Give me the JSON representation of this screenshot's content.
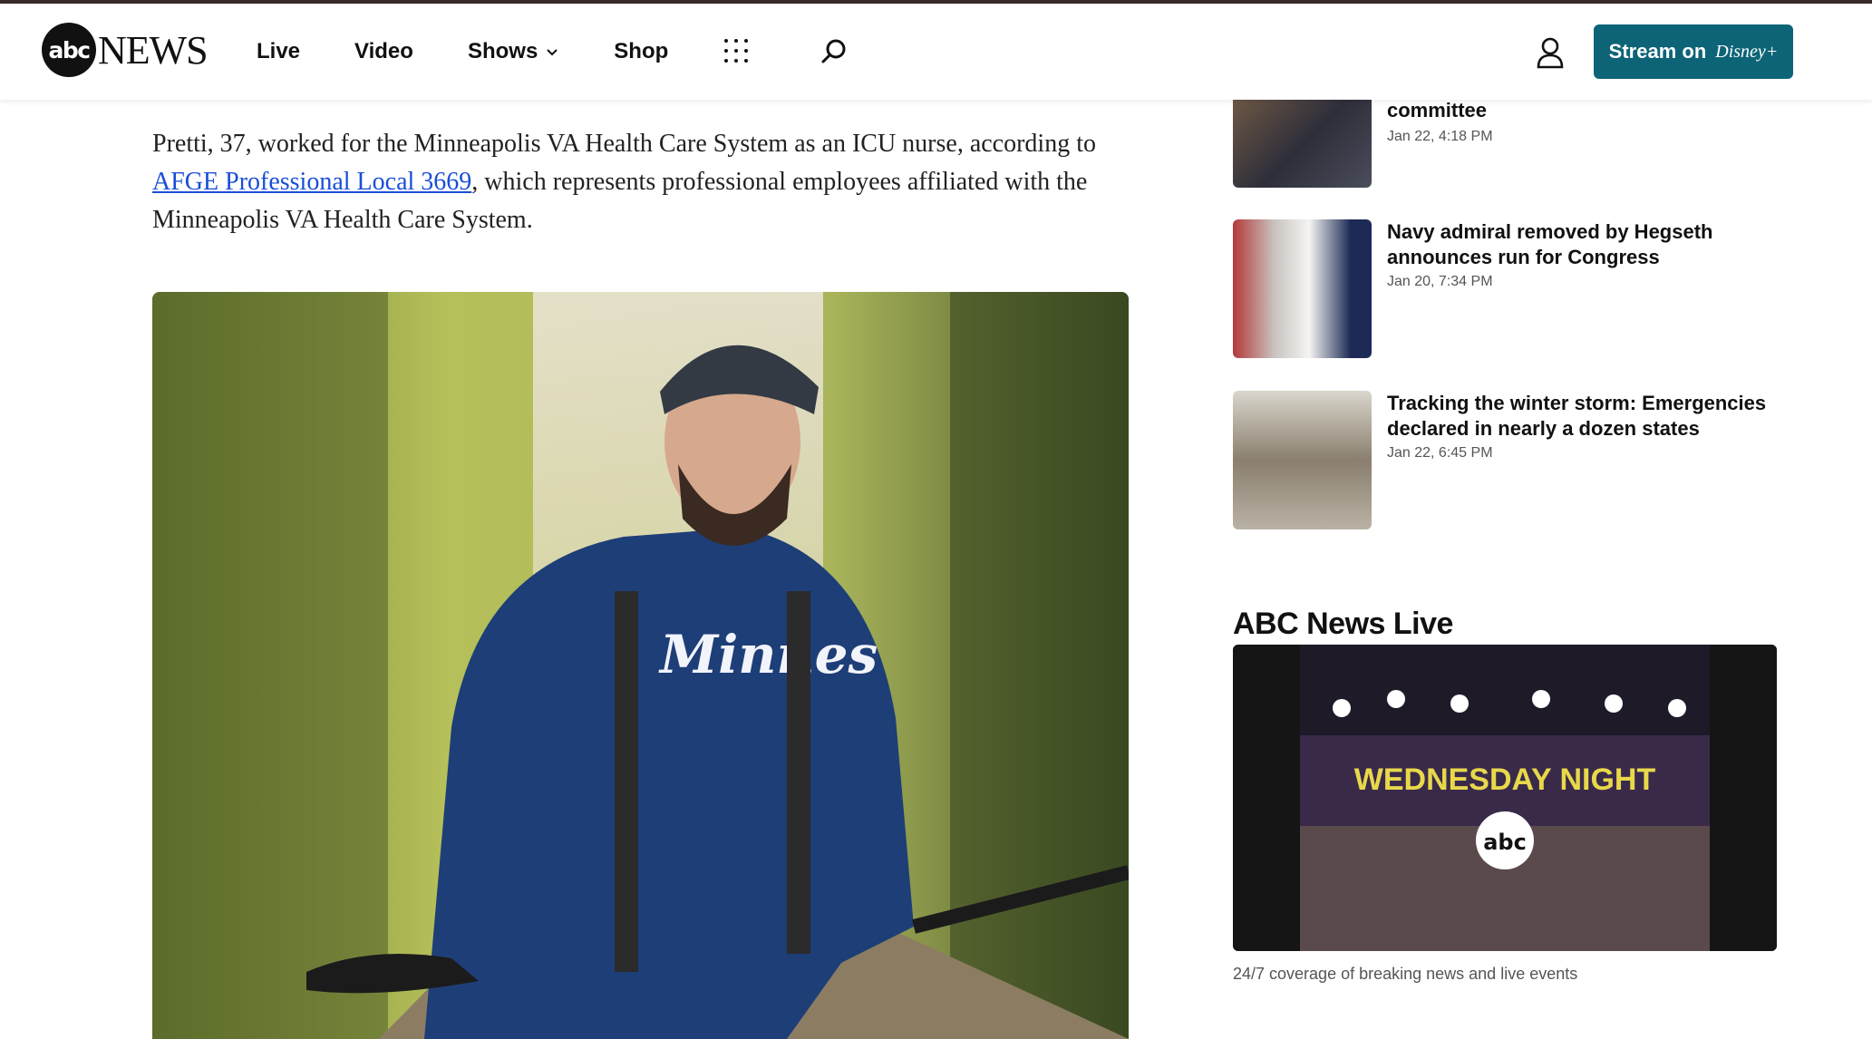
{
  "header": {
    "logo_abc": "abc",
    "logo_news": "NEWS",
    "nav": [
      "Live",
      "Video",
      "Shows",
      "Shop"
    ],
    "stream_label": "Stream on",
    "stream_brand": "Disney+"
  },
  "article": {
    "para_before_link": "Pretti, 37, worked for the Minneapolis VA Health Care System as an ICU nurse, according to ",
    "link_text": "AFGE Professional Local 3669",
    "para_after_link": ", which represents professional employees affiliated with the Minneapolis VA Health Care System.",
    "photo_jersey_text": "Minnes"
  },
  "sidebar": {
    "items": [
      {
        "title": "committee",
        "date": "Jan 22, 4:18 PM"
      },
      {
        "title": "Navy admiral removed by Hegseth announces run for Congress",
        "date": "Jan 20, 7:34 PM"
      },
      {
        "title": "Tracking the winter storm: Emergencies declared in nearly a dozen states",
        "date": "Jan 22, 6:45 PM"
      }
    ]
  },
  "live": {
    "heading": "ABC News Live",
    "video_text": "WEDNESDAY NIGHT",
    "video_logo": "abc",
    "caption": "24/7 coverage of breaking news and live events"
  },
  "colors": {
    "stream_button": "#0d6477",
    "link": "#1a4ed8",
    "video_title": "#e8d84a"
  },
  "icons": [
    "grid-menu-icon",
    "search-icon",
    "user-icon",
    "chevron-down-icon"
  ]
}
